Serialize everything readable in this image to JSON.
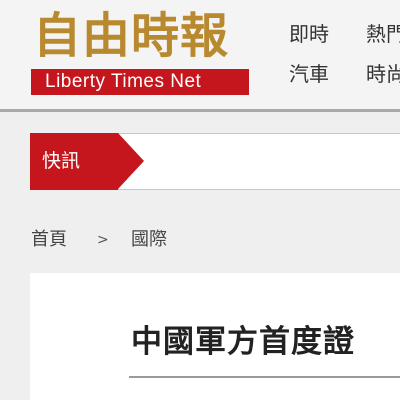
{
  "logo": {
    "chinese": "自由時報",
    "english": "Liberty Times Net"
  },
  "nav": {
    "items": [
      "即時",
      "熱門",
      "汽車",
      "時尚"
    ]
  },
  "flash": {
    "label": "快訊"
  },
  "breadcrumb": {
    "home": "首頁",
    "separator": ">",
    "section": "國際"
  },
  "article": {
    "title": "中國軍方首度證"
  },
  "colors": {
    "brand_red": "#c5161d",
    "logo_gold": "#b9892f",
    "header_bg": "#f4f4f4",
    "page_bg": "#efefef"
  }
}
